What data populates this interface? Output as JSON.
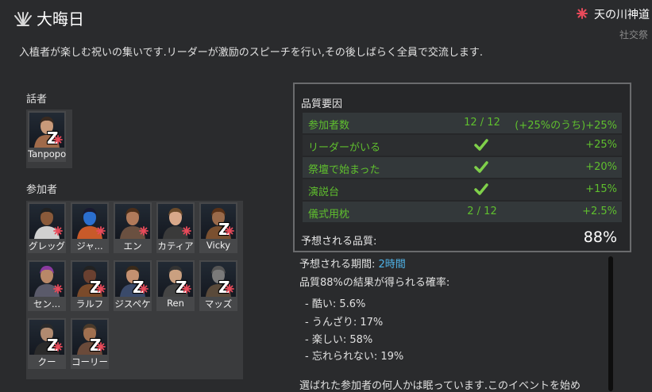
{
  "header": {
    "title": "大晦日",
    "ideoligion": "天の川神道",
    "meme": "社交祭",
    "description": "入植者が楽しむ祝いの集いです.リーダーが激励のスピーチを行い,その後しばらく全員で交流します."
  },
  "speaker_section": {
    "label": "話者",
    "pawns": [
      {
        "name": "Tanpopo",
        "asleep": true
      }
    ]
  },
  "participants_section": {
    "label": "参加者",
    "pawns": [
      {
        "name": "グレッグ",
        "asleep": false
      },
      {
        "name": "ジャ...",
        "asleep": false
      },
      {
        "name": "エン",
        "asleep": false
      },
      {
        "name": "カティア",
        "asleep": false
      },
      {
        "name": "Vicky",
        "asleep": true
      },
      {
        "name": "セン...",
        "asleep": false
      },
      {
        "name": "ラルフ",
        "asleep": true
      },
      {
        "name": "ジスペケ",
        "asleep": true
      },
      {
        "name": "Ren",
        "asleep": true
      },
      {
        "name": "マッズ",
        "asleep": true
      },
      {
        "name": "クー",
        "asleep": true
      },
      {
        "name": "コーリー",
        "asleep": true
      }
    ],
    "sleep_mark": "Z"
  },
  "quality_panel": {
    "title": "品質要因",
    "rows": [
      {
        "label": "参加者数",
        "middle": "12 / 12",
        "bonus": "(+25%のうち)+25%",
        "checked": false
      },
      {
        "label": "リーダーがいる",
        "middle": "",
        "bonus": "+25%",
        "checked": true
      },
      {
        "label": "祭壇で始まった",
        "middle": "",
        "bonus": "+20%",
        "checked": true
      },
      {
        "label": "演説台",
        "middle": "",
        "bonus": "+15%",
        "checked": true
      },
      {
        "label": "儀式用枕",
        "middle": "2 / 12",
        "bonus": "+2.5%",
        "checked": false
      }
    ],
    "expected_label": "予想される品質:",
    "expected_value": "88%"
  },
  "outcome": {
    "duration_label": "予想される期間: ",
    "duration_value": "2時間",
    "chance_label": "品質88%の結果が得られる確率:",
    "outcomes": [
      "- 酷い: 5.6%",
      "- うんざり: 17%",
      "- 楽しい: 58%",
      "- 忘れられない: 19%"
    ],
    "warning": "選ばれた参加者の何人かは眠っています.このイベントを始め"
  },
  "colors": {
    "background": "#2a2b2d",
    "positive": "#5fbf2e",
    "accent_blue": "#4fb3e8",
    "ideo_red": "#e84a5a"
  }
}
